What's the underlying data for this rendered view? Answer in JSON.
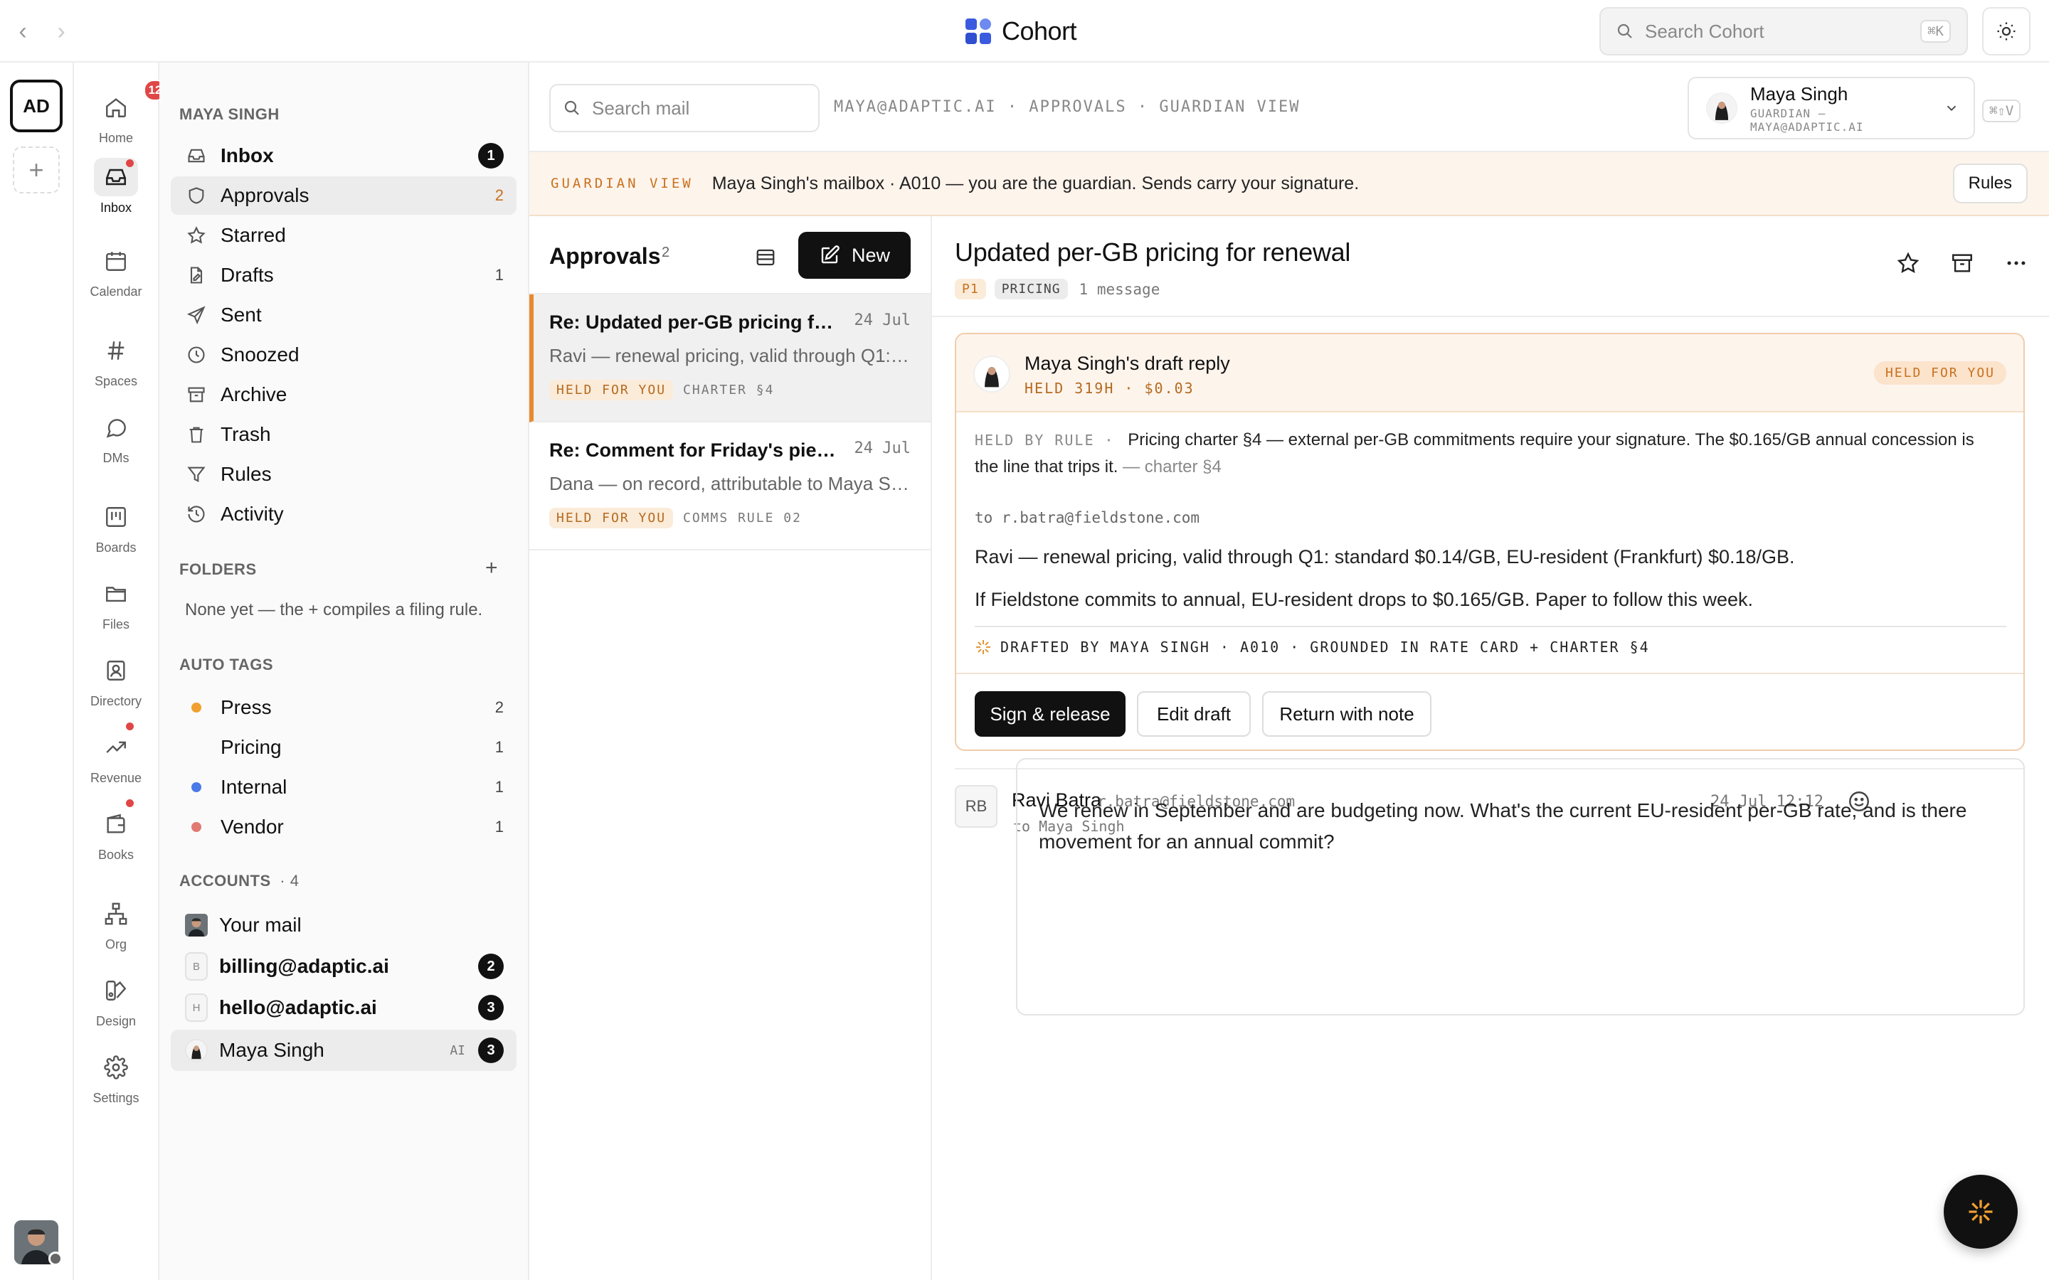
{
  "app": {
    "name": "Cohort",
    "search_placeholder": "Search Cohort",
    "search_kbd": "⌘K"
  },
  "workspace": {
    "initials": "AD",
    "add": "+"
  },
  "rail": {
    "home": "Home",
    "home_badge": "12",
    "inbox": "Inbox",
    "calendar": "Calendar",
    "spaces": "Spaces",
    "dms": "DMs",
    "boards": "Boards",
    "files": "Files",
    "directory": "Directory",
    "revenue": "Revenue",
    "books": "Books",
    "org": "Org",
    "design": "Design",
    "settings": "Settings"
  },
  "sidebar": {
    "owner": "MAYA SINGH",
    "folders_nav": [
      {
        "label": "Inbox",
        "count": "1"
      },
      {
        "label": "Approvals",
        "count": "2"
      },
      {
        "label": "Starred",
        "count": ""
      },
      {
        "label": "Drafts",
        "count": "1"
      },
      {
        "label": "Sent",
        "count": ""
      },
      {
        "label": "Snoozed",
        "count": ""
      },
      {
        "label": "Archive",
        "count": ""
      },
      {
        "label": "Trash",
        "count": ""
      },
      {
        "label": "Rules",
        "count": ""
      },
      {
        "label": "Activity",
        "count": ""
      }
    ],
    "folders_title": "FOLDERS",
    "folders_empty": "None yet — the + compiles a filing rule.",
    "auto_tags_title": "AUTO TAGS",
    "auto_tags": [
      {
        "label": "Press",
        "count": "2",
        "color": "#f0a030"
      },
      {
        "label": "Pricing",
        "count": "1",
        "color": ""
      },
      {
        "label": "Internal",
        "count": "1",
        "color": "#4a7ae8"
      },
      {
        "label": "Vendor",
        "count": "1",
        "color": "#e07a72"
      }
    ],
    "accounts_title": "ACCOUNTS",
    "accounts_count": "· 4",
    "accounts": [
      {
        "label": "Your mail",
        "initial": "",
        "badge": ""
      },
      {
        "label": "billing@adaptic.ai",
        "initial": "B",
        "badge": "2"
      },
      {
        "label": "hello@adaptic.ai",
        "initial": "H",
        "badge": "3"
      },
      {
        "label": "Maya Singh",
        "initial": "",
        "badge": "3",
        "tag": "AI"
      }
    ]
  },
  "header": {
    "search_placeholder": "Search mail",
    "breadcrumb": "MAYA@ADAPTIC.AI · APPROVALS · GUARDIAN VIEW",
    "user_name": "Maya Singh",
    "user_sub": "GUARDIAN — MAYA@ADAPTIC.AI",
    "switch_kbd": "⌘⇧V"
  },
  "banner": {
    "tag": "GUARDIAN VIEW",
    "text": "Maya Singh's mailbox · A010 — you are the guardian. Sends carry your signature.",
    "button": "Rules"
  },
  "list": {
    "title": "Approvals",
    "count": "2",
    "new_label": "New",
    "messages": [
      {
        "subject": "Re: Updated per-GB pricing for renewal",
        "date": "24 Jul",
        "preview": "Ravi — renewal pricing, valid through Q1: standard $0.14/GB, EU-resident (Frankfurt) $0.18/GB.",
        "tag": "HELD FOR YOU",
        "ref": "CHARTER §4"
      },
      {
        "subject": "Re: Comment for Friday's piece on AI governance",
        "date": "24 Jul",
        "preview": "Dana — on record, attributable to Maya Singh, Adaptic.",
        "tag": "HELD FOR YOU",
        "ref": "COMMS RULE 02"
      }
    ]
  },
  "reader": {
    "title": "Updated per-GB pricing for renewal",
    "priority": "P1",
    "label": "PRICING",
    "message_count": "1 message",
    "draft": {
      "from": "Maya Singh's draft reply",
      "stats": "HELD 319H · $0.03",
      "status": "HELD FOR YOU",
      "rule_key": "HELD BY RULE ·",
      "rule_text": "Pricing charter §4 — external per-GB commitments require your signature. The $0.165/GB annual concession is the line that trips it.",
      "rule_ref": "— charter §4",
      "to": "to r.batra@fieldstone.com",
      "body1": "Ravi — renewal pricing, valid through Q1: standard $0.14/GB, EU-resident (Frankfurt) $0.18/GB.",
      "body2": "If Fieldstone commits to annual, EU-resident drops to $0.165/GB. Paper to follow this week.",
      "signature": "DRAFTED BY MAYA SINGH · A010 · GROUNDED IN RATE CARD + CHARTER §4",
      "sign_btn": "Sign & release",
      "edit_btn": "Edit draft",
      "return_btn": "Return with note"
    },
    "reply": {
      "initials": "RB",
      "name": "Ravi Batra",
      "address": "r.batra@fieldstone.com",
      "to": "to Maya Singh",
      "time": "24 Jul 12:12",
      "body": "We renew in September and are budgeting now. What's the current EU-resident per-GB rate, and is there movement for an annual commit?"
    }
  },
  "colors": {
    "accent": "#c9711e",
    "banner_bg": "#fdf4ec",
    "badge_red": "#e04646"
  }
}
